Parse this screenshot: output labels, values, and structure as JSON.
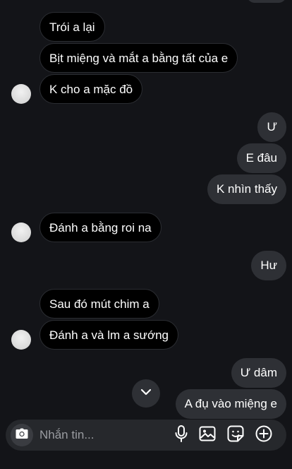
{
  "messages": [
    {
      "side": "in",
      "text": "Trói a lại"
    },
    {
      "side": "in",
      "text": "Bịt miệng và mắt a bằng tất của e"
    },
    {
      "side": "in",
      "text": "K cho a mặc đồ"
    },
    {
      "side": "out",
      "text": "Ư"
    },
    {
      "side": "out",
      "text": "E đâu"
    },
    {
      "side": "out",
      "text": "K nhìn thấy"
    },
    {
      "side": "in",
      "text": "Đánh a bằng roi na"
    },
    {
      "side": "out",
      "text": "Hư"
    },
    {
      "side": "in",
      "text": "Sau đó mút chim a"
    },
    {
      "side": "in",
      "text": "Đánh a và lm a sướng"
    },
    {
      "side": "out",
      "text": "Ư dâm"
    },
    {
      "side": "out",
      "text": "A đụ vào miệng e"
    }
  ],
  "composer": {
    "placeholder": "Nhắn tin..."
  },
  "icons": {
    "camera": "camera-icon",
    "mic": "microphone-icon",
    "gallery": "image-icon",
    "sticker": "sticker-icon",
    "add": "plus-circle-icon",
    "scroll": "chevron-down-icon"
  },
  "colors": {
    "background": "#131418",
    "incoming_bubble": "#000000",
    "outgoing_bubble": "#2e3035",
    "composer": "#26282c"
  }
}
